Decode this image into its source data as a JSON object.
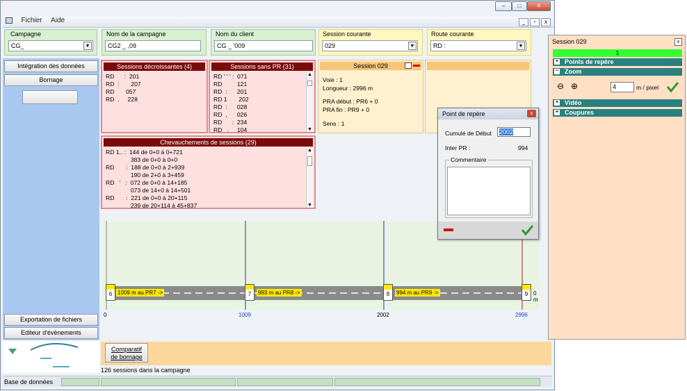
{
  "menu": {
    "items": [
      "Fichier",
      "Aide"
    ]
  },
  "filters": {
    "campagne": {
      "label": "Campagne",
      "value": "CG_"
    },
    "nom_campagne": {
      "label": "Nom de la campagne",
      "value": "CG2 _ ,09"
    },
    "nom_client": {
      "label": "Nom du client",
      "value": "CG _ '009"
    },
    "session_courante": {
      "label": "Session courante",
      "value": "029"
    },
    "route_courante": {
      "label": "Route courante",
      "value": "RD :"
    }
  },
  "sidebar": {
    "integration": "Intégration des données",
    "bornage": "Bornage",
    "export": "Exportation de fichiers",
    "editeur": "Editeur d'évènements"
  },
  "panels": {
    "decroissantes": {
      "title": "Sessions décroissantes (4)",
      "lines": [
        "RD      :  201",
        "RD  :       207",
        "RD       057",
        "RD  .     228"
      ]
    },
    "sans_pr": {
      "title": "Sessions sans PR (31)",
      "lines": [
        "RD ' ' ' :  071",
        "RD         121",
        "RD  :      201",
        "RD 1       202",
        "RD  :      028",
        "RD  ,      026",
        "RD      :  234",
        "RD   .     104"
      ]
    },
    "chevauchements": {
      "title": "Chevauchements de sessions (29)",
      "lines": [
        "RD 1.. :  144 de 0+0 à 0+721",
        "               383 de 0+0 à 0+0",
        "RD       :  188 de 0+0 à 2+939",
        "               190 de 2+0 à 3+459",
        "RD   '   :  072 de 0+0 à 14+185",
        "               073 de 14+0 à 14+501",
        "RD       :  221 de 0+0 à 20+115",
        "               239 de 20+114 à 45+837"
      ]
    },
    "session": {
      "title": "Session 029",
      "lines": [
        "Voie : 1",
        "Longueur : 2996 m",
        "",
        "PRA début : PR6 + 0",
        "PRA fin : PR9 + 0",
        "",
        "Sens : 1"
      ]
    }
  },
  "chart": {
    "markers": [
      "6",
      "7",
      "8",
      "9"
    ],
    "segment_labels": [
      "1009 m au PR7 ->",
      "993 m au PR8 ->",
      "994 m au PR9 ->"
    ],
    "end_label": "0 m",
    "ticks": [
      "0",
      "1009",
      "2002",
      "2996"
    ]
  },
  "comparatif_button": "Comparatif\nde bornage",
  "sessions_count": "126 sessions dans la campagne",
  "status": {
    "db": "Base de données"
  },
  "dialog": {
    "title": "Point de repère",
    "cumul_label": "Cumulé de Début",
    "cumul_value": "2002",
    "inter_label": "Inter PR :",
    "inter_value": "994",
    "comment_label": "Commentaire"
  },
  "right_panel": {
    "title": "Session 029",
    "progress": "1",
    "rows": [
      "Points de repère",
      "Zoom",
      "Vidéo",
      "Coupures"
    ],
    "zoom_value": "4",
    "zoom_unit": "m / pixel"
  },
  "colors": {
    "sidebar": "#a9c8f0",
    "red_header": "#7a0b0b",
    "teal": "#2a8080",
    "green_bar": "#33ff33",
    "orange": "#f6c57a"
  }
}
